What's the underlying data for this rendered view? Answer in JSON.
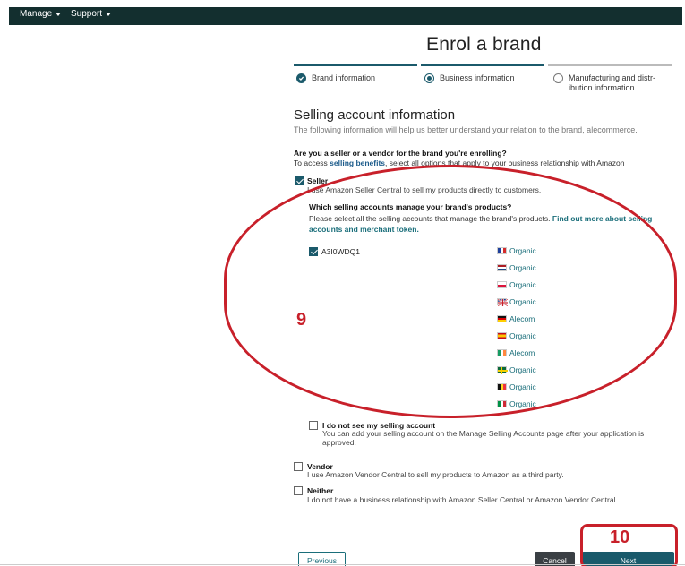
{
  "topbar": {
    "items": [
      {
        "label": "Manage"
      },
      {
        "label": "Support"
      }
    ]
  },
  "page": {
    "title": "Enrol a brand"
  },
  "steps": [
    {
      "label_line1": "Brand information",
      "label_line2": "",
      "state": "done"
    },
    {
      "label_line1": "Business information",
      "label_line2": "",
      "state": "current"
    },
    {
      "label_line1": "Manufacturing and distr-",
      "label_line2": "ibution information",
      "state": "todo"
    }
  ],
  "section": {
    "title": "Selling account information",
    "subtitle": "The following information will help us better understand your relation to the brand, alecommerce."
  },
  "question": {
    "text": "Are you a seller or a vendor for the brand you're enrolling?",
    "sub_prefix": "To access ",
    "sub_link": "selling benefits",
    "sub_suffix": ", select all options that apply to your business relationship with Amazon"
  },
  "seller": {
    "label": "Seller",
    "description": "I use Amazon Seller Central to sell my products directly to customers.",
    "checked": true,
    "accounts_question": "Which selling accounts manage your brand's products?",
    "accounts_desc": "Please select all the selling accounts that manage the brand's products.",
    "accounts_link": "Find out more about selling accounts and merchant token.",
    "account_id": "A3I0WDQ1",
    "account_checked": true,
    "marketplaces": [
      {
        "flag": "fr",
        "label": "Organic"
      },
      {
        "flag": "nl",
        "label": "Organic"
      },
      {
        "flag": "pl",
        "label": "Organic"
      },
      {
        "flag": "uk",
        "label": "Organic"
      },
      {
        "flag": "de",
        "label": "Alecom"
      },
      {
        "flag": "es",
        "label": "Organic"
      },
      {
        "flag": "ie",
        "label": "Alecom"
      },
      {
        "flag": "se",
        "label": "Organic"
      },
      {
        "flag": "be",
        "label": "Organic"
      },
      {
        "flag": "it",
        "label": "Organic"
      }
    ],
    "no_account_label": "I do not see my selling account",
    "no_account_desc_1": "You can add your selling account on the Manage Selling Accounts page after your application is",
    "no_account_desc_2": "approved."
  },
  "vendor": {
    "label": "Vendor",
    "description": "I use Amazon Vendor Central to sell my products to Amazon as a third party."
  },
  "neither": {
    "label": "Neither",
    "description": "I do not have a business relationship with Amazon Seller Central or Amazon Vendor Central."
  },
  "buttons": {
    "previous": "Previous",
    "cancel": "Cancel",
    "next": "Next"
  },
  "annotations": {
    "marker_9": "9",
    "marker_10": "10",
    "color": "#c8202a"
  },
  "colors": {
    "topbar": "#132f2f",
    "accent": "#1b5a6b",
    "link": "#1a6e7a"
  }
}
